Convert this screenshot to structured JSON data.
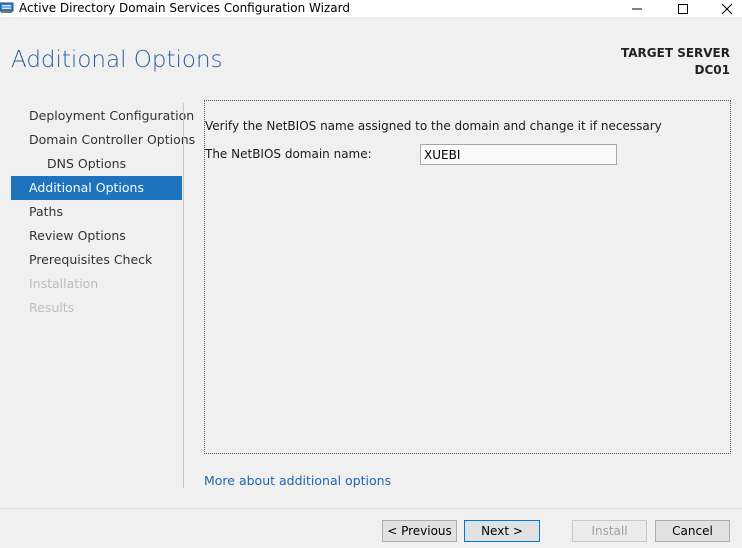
{
  "window": {
    "title": "Active Directory Domain Services Configuration Wizard",
    "minimize_glyph": "—",
    "close_glyph": "✕"
  },
  "header": {
    "page_title": "Additional Options",
    "target_server_label": "TARGET SERVER",
    "target_server_name": "DC01"
  },
  "nav": {
    "items": [
      {
        "label": "Deployment Configuration",
        "state": "normal"
      },
      {
        "label": "Domain Controller Options",
        "state": "normal"
      },
      {
        "label": "DNS Options",
        "state": "sub"
      },
      {
        "label": "Additional Options",
        "state": "active"
      },
      {
        "label": "Paths",
        "state": "normal"
      },
      {
        "label": "Review Options",
        "state": "normal"
      },
      {
        "label": "Prerequisites Check",
        "state": "normal"
      },
      {
        "label": "Installation",
        "state": "disabled"
      },
      {
        "label": "Results",
        "state": "disabled"
      }
    ]
  },
  "content": {
    "instruction": "Verify the NetBIOS name assigned to the domain and change it if necessary",
    "netbios_label": "The NetBIOS domain name:",
    "netbios_value": "XUEBI",
    "more_link": "More about additional options"
  },
  "buttons": {
    "previous": "< Previous",
    "next": "Next >",
    "install": "Install",
    "cancel": "Cancel"
  },
  "colors": {
    "accent": "#1e73be",
    "title": "#2a5fa0",
    "link": "#1e66b0"
  },
  "icons": {
    "app": "server-manager-icon",
    "minimize": "minimize-icon",
    "maximize": "maximize-icon",
    "close": "close-icon"
  }
}
